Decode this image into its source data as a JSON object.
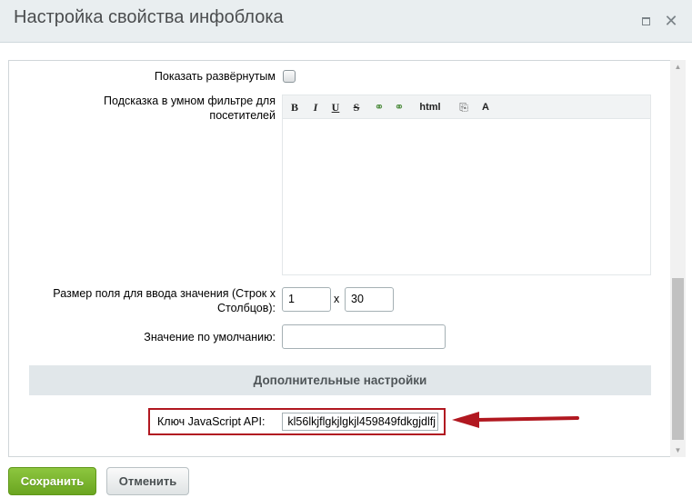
{
  "window": {
    "title": "Настройка свойства инфоблока",
    "maximize_icon": "maximize-icon",
    "close_icon": "close-icon",
    "close_glyph": "✕"
  },
  "form": {
    "show_expanded_label": "Показать развёрнутым",
    "hint_label": "Подсказка в умном фильтре для посетителей",
    "editor_toolbar": {
      "bold": "B",
      "italic": "I",
      "underline": "U",
      "strike": "S",
      "link": "⚭",
      "unlink": "⚭",
      "html": "html",
      "paste": "⎘",
      "font": "A"
    },
    "size_label": "Размер поля для ввода значения (Строк x Столбцов):",
    "rows_value": "1",
    "x_separator": "x",
    "cols_value": "30",
    "default_label": "Значение по умолчанию:",
    "default_value": ""
  },
  "extra_section": {
    "title": "Дополнительные настройки",
    "api_key_label": "Ключ JavaScript API:",
    "api_key_value": "kl56lkjflgkjlgkjl459849fdkgjdlfj"
  },
  "scrollbar": {
    "up_glyph": "▲",
    "down_glyph": "▼"
  },
  "footer": {
    "save_label": "Сохранить",
    "cancel_label": "Отменить"
  },
  "colors": {
    "highlight": "#b11820",
    "save_button": "#6aa520",
    "section_header_bg": "#e1e7ea"
  }
}
